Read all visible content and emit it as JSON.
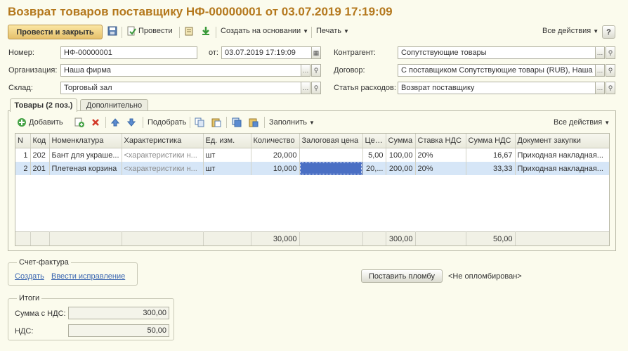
{
  "title": "Возврат товаров поставщику НФ-00000001 от 03.07.2019 17:19:09",
  "toolbar": {
    "post_close": "Провести и закрыть",
    "post": "Провести",
    "create_based": "Создать на основании",
    "print": "Печать",
    "all_actions": "Все действия",
    "help": "?"
  },
  "form": {
    "number_label": "Номер:",
    "number_value": "НФ-00000001",
    "date_label": "от:",
    "date_value": "03.07.2019 17:19:09",
    "org_label": "Организация:",
    "org_value": "Наша фирма",
    "warehouse_label": "Склад:",
    "warehouse_value": "Торговый зал",
    "counterparty_label": "Контрагент:",
    "counterparty_value": "Сопутствующие товары",
    "contract_label": "Договор:",
    "contract_value": "С поставщиком Сопутствующие товары (RUB), Наша ф",
    "expense_label": "Статья расходов:",
    "expense_value": "Возврат поставщику"
  },
  "tabs": {
    "goods": "Товары (2 поз.)",
    "additional": "Дополнительно"
  },
  "grid_toolbar": {
    "add": "Добавить",
    "pick": "Подобрать",
    "fill": "Заполнить",
    "all_actions": "Все действия"
  },
  "table": {
    "headers": {
      "n": "N",
      "code": "Код",
      "item": "Номенклатура",
      "char": "Характеристика",
      "unit": "Ед. изм.",
      "qty": "Количество",
      "deposit": "Залоговая цена",
      "price": "Цена",
      "sum": "Сумма",
      "vat_rate": "Ставка НДС",
      "vat_sum": "Сумма НДС",
      "doc": "Документ закупки"
    },
    "rows": [
      {
        "n": "1",
        "code": "202",
        "item": "Бант для украше...",
        "char": "<характеристики н...",
        "unit": "шт",
        "qty": "20,000",
        "deposit": "",
        "price": "5,00",
        "sum": "100,00",
        "vat_rate": "20%",
        "vat_sum": "16,67",
        "doc": "Приходная накладная..."
      },
      {
        "n": "2",
        "code": "201",
        "item": "Плетеная корзина",
        "char": "<характеристики н...",
        "unit": "шт",
        "qty": "10,000",
        "deposit": "",
        "price": "20,...",
        "sum": "200,00",
        "vat_rate": "20%",
        "vat_sum": "33,33",
        "doc": "Приходная накладная..."
      }
    ],
    "totals": {
      "qty": "30,000",
      "sum": "300,00",
      "vat_sum": "50,00"
    }
  },
  "invoice": {
    "title": "Счет-фактура",
    "create": "Создать",
    "correction": "Ввести исправление"
  },
  "seal": {
    "button": "Поставить пломбу",
    "status": "<Не опломбирован>"
  },
  "totals": {
    "title": "Итоги",
    "sum_vat_label": "Сумма с НДС:",
    "sum_vat_value": "300,00",
    "vat_label": "НДС:",
    "vat_value": "50,00"
  }
}
